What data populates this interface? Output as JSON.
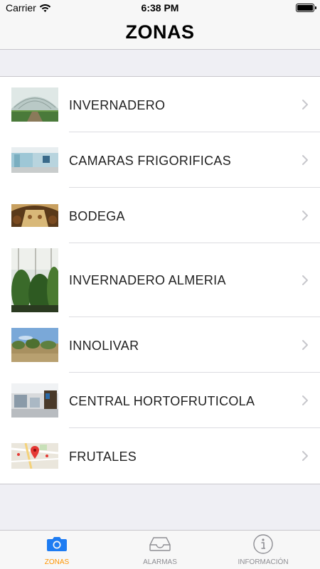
{
  "status_bar": {
    "carrier": "Carrier",
    "time": "6:38 PM"
  },
  "nav": {
    "title": "ZONAS"
  },
  "zones": [
    {
      "label": "INVERNADERO",
      "image": "greenhouse-tunnel-photo"
    },
    {
      "label": "CAMARAS FRIGORIFICAS",
      "image": "cold-storage-room-photo"
    },
    {
      "label": "BODEGA",
      "image": "wine-cellar-barrels-photo"
    },
    {
      "label": "INVERNADERO ALMERIA",
      "image": "greenhouse-plants-photo"
    },
    {
      "label": "INNOLIVAR",
      "image": "olive-grove-photo"
    },
    {
      "label": "CENTRAL HORTOFRUTICOLA",
      "image": "warehouse-interior-photo"
    },
    {
      "label": "FRUTALES",
      "image": "map-pin-thumbnail"
    }
  ],
  "tabs": [
    {
      "label": "ZONAS",
      "icon": "camera-icon",
      "active": true
    },
    {
      "label": "ALARMAS",
      "icon": "inbox-tray-icon",
      "active": false
    },
    {
      "label": "INFORMACIÓN",
      "icon": "info-circle-icon",
      "active": false
    }
  ],
  "colors": {
    "accent": "#ff9500",
    "tab_active_icon": "#1e7cf2",
    "tab_inactive": "#8e8e93"
  }
}
